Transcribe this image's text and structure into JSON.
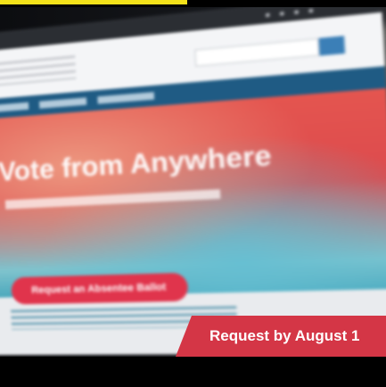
{
  "caption": {
    "text": "Request by August 1",
    "color": "#d43646"
  },
  "screen": {
    "hero_title": "Vote from Anywhere",
    "hero_button": "Request an Absentee Ballot"
  },
  "colors": {
    "accent_yellow": "#f4e21a",
    "nav_blue": "#1f5b84",
    "hero_red": "#e4554f",
    "hero_teal": "#4aa8bc"
  }
}
